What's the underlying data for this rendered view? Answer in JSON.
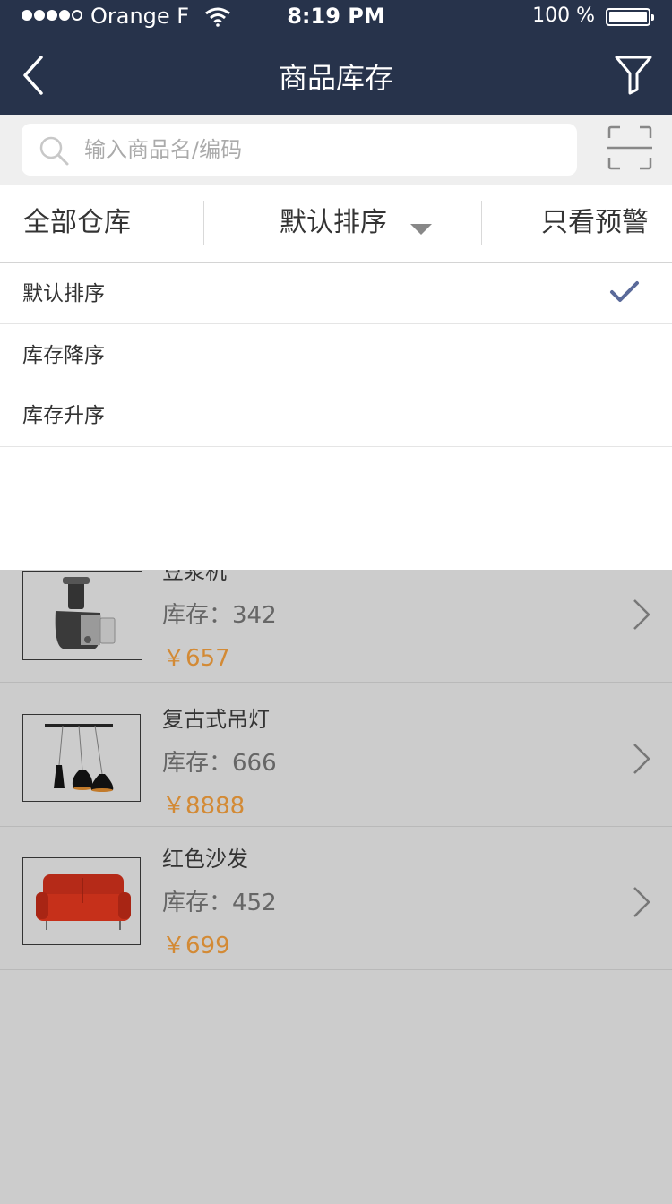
{
  "status_bar": {
    "carrier": "Orange F",
    "time": "8:19 PM",
    "battery": "100 %"
  },
  "nav": {
    "title": "商品库存",
    "back_icon": "chevron-left-icon",
    "filter_icon": "funnel-icon"
  },
  "search": {
    "placeholder": "输入商品名/编码",
    "value": "",
    "scan_icon": "scan-frame-icon"
  },
  "filter_bar": {
    "warehouse": "全部仓库",
    "sort": "默认排序",
    "warning_only": "只看预警"
  },
  "sort_dropdown": {
    "options": [
      {
        "label": "默认排序",
        "selected": true
      },
      {
        "label": "库存降序",
        "selected": false
      },
      {
        "label": "库存升序",
        "selected": false
      }
    ]
  },
  "products": [
    {
      "name": "豆浆机",
      "stock_label": "库存：342",
      "price": "￥657",
      "image": "juicer"
    },
    {
      "name": "复古式吊灯",
      "stock_label": "库存：666",
      "price": "￥8888",
      "image": "pendant-lamp"
    },
    {
      "name": "红色沙发",
      "stock_label": "库存：452",
      "price": "￥699",
      "image": "red-sofa"
    }
  ],
  "colors": {
    "nav_bg": "#27334b",
    "price": "#d38a35",
    "check": "#5a6a9a",
    "overlay_bg": "#cccccc"
  }
}
